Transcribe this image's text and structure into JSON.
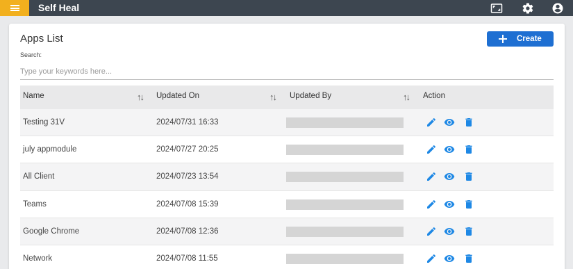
{
  "header": {
    "app_title": "Self Heal",
    "icons": [
      "menu-icon",
      "fullscreen-icon",
      "settings-icon",
      "account-icon"
    ],
    "bar_color": "#3d4650",
    "menu_color": "#f2b01e"
  },
  "page": {
    "title": "Apps List",
    "create_label": "Create",
    "search_label": "Search:",
    "search_placeholder": "Type your keywords here...",
    "search_value": ""
  },
  "table": {
    "columns": [
      "Name",
      "Updated On",
      "Updated By",
      "Action"
    ],
    "rows": [
      {
        "name": "Testing 31V",
        "updated_on": "2024/07/31 16:33"
      },
      {
        "name": "july appmodule",
        "updated_on": "2024/07/27 20:25"
      },
      {
        "name": "All Client",
        "updated_on": "2024/07/23 13:54"
      },
      {
        "name": "Teams",
        "updated_on": "2024/07/08 15:39"
      },
      {
        "name": "Google Chrome",
        "updated_on": "2024/07/08 12:36"
      },
      {
        "name": "Network",
        "updated_on": "2024/07/08 11:55"
      }
    ],
    "row_actions": [
      "edit-icon",
      "view-icon",
      "delete-icon"
    ]
  },
  "colors": {
    "accent": "#1e6fd2",
    "action_icon": "#1e88e5"
  }
}
